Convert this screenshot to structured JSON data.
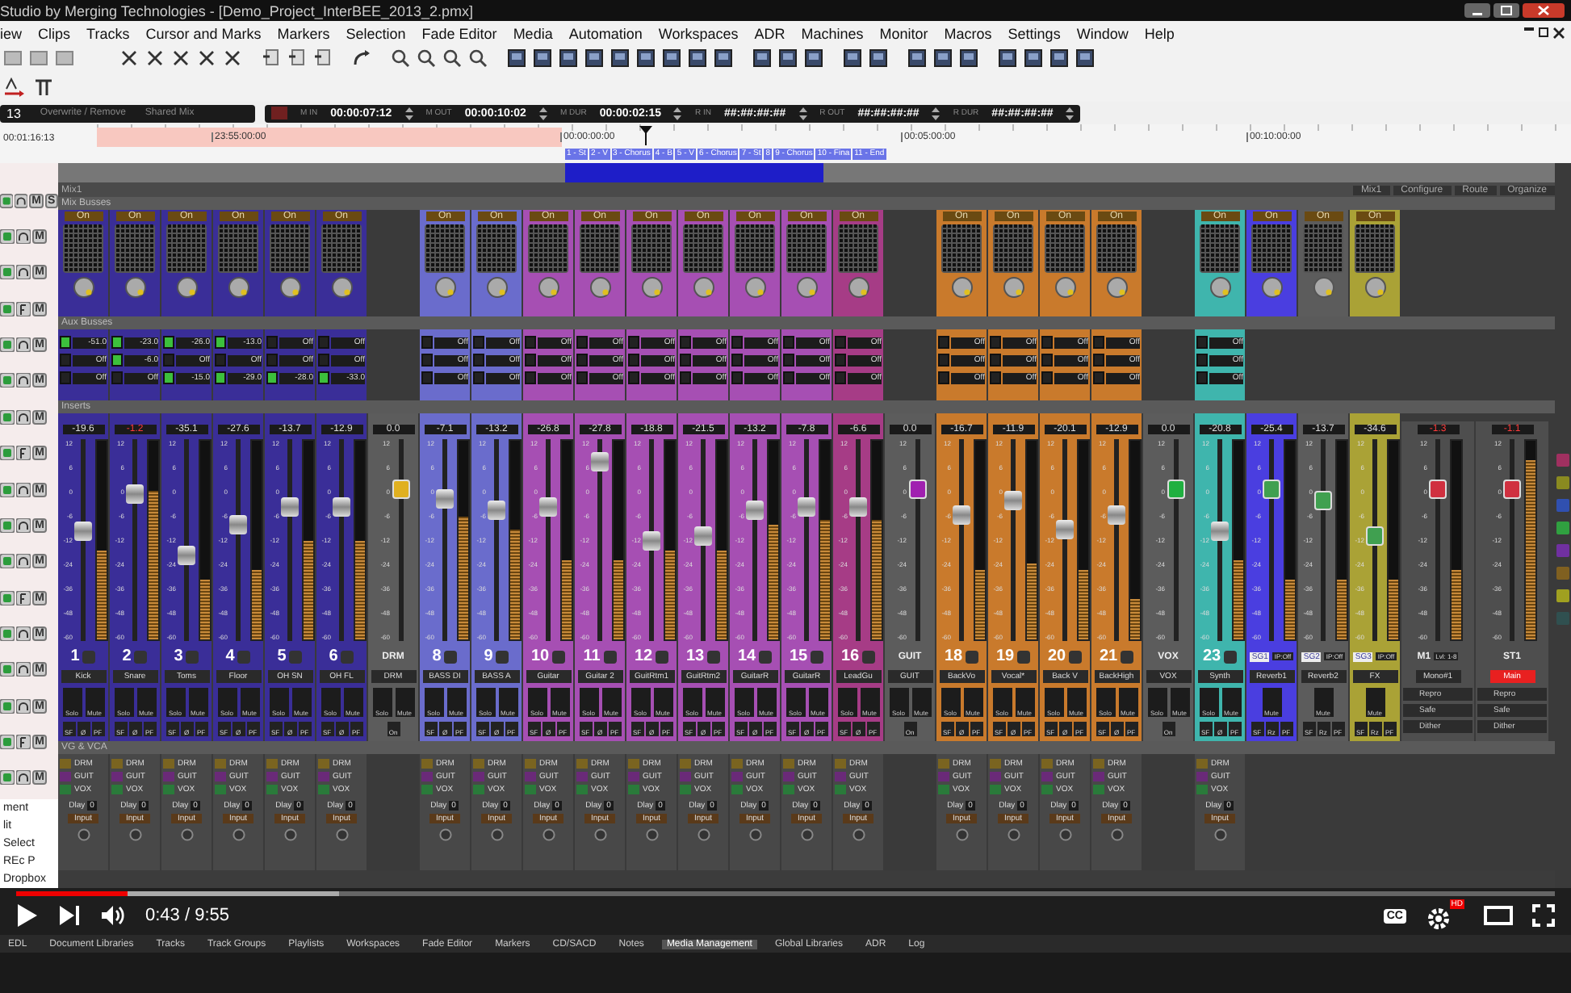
{
  "window": {
    "title": "Studio by Merging Technologies - [Demo_Project_InterBEE_2013_2.pmx]"
  },
  "menu": [
    "iew",
    "Clips",
    "Tracks",
    "Cursor and Marks",
    "Markers",
    "Selection",
    "Fade Editor",
    "Media",
    "Automation",
    "Workspaces",
    "ADR",
    "Machines",
    "Monitor",
    "Macros",
    "Settings",
    "Window",
    "Help"
  ],
  "transport": {
    "track": "13",
    "mode": "Overwrite / Remove",
    "mix": "Shared Mix",
    "fields": [
      {
        "label": "M IN",
        "value": "00:00:07:12"
      },
      {
        "label": "M OUT",
        "value": "00:00:10:02"
      },
      {
        "label": "M DUR",
        "value": "00:00:02:15"
      },
      {
        "label": "R IN",
        "value": "##:##:##:##"
      },
      {
        "label": "R OUT",
        "value": "##:##:##:##"
      },
      {
        "label": "R DUR",
        "value": "##:##:##:##"
      }
    ]
  },
  "ruler": {
    "position": "00:01:16:13",
    "ticks": [
      "23:55:00:00",
      "00:00:00:00",
      "00:05:00:00",
      "00:10:00:00"
    ],
    "markers": [
      "1 - St",
      "2 - V",
      "3 - Chorus",
      "4 - B",
      "5 - V",
      "6 - Chorus",
      "7 - St",
      "8",
      "9 - Chorus",
      "10 - Fina",
      "11 - End"
    ]
  },
  "tracks": [
    {
      "mute": "M",
      "solo": "S"
    },
    {
      "mute": "M"
    },
    {
      "mute": "M"
    },
    {
      "mute": "M"
    },
    {
      "mute": "M"
    },
    {
      "mute": "M"
    },
    {
      "mute": "M"
    },
    {
      "mute": "M"
    },
    {
      "mute": "M"
    },
    {
      "mute": "M"
    },
    {
      "mute": "M"
    },
    {
      "mute": "M"
    },
    {
      "mute": "M"
    },
    {
      "mute": "M"
    },
    {
      "mute": "M"
    },
    {
      "mute": "M"
    },
    {
      "mute": "M"
    }
  ],
  "side_panel": [
    "ment",
    "lit",
    "Select",
    "REc P",
    "Dropbox"
  ],
  "mixer": {
    "title": "Mix1",
    "buttons": [
      "Mix1",
      "Configure",
      "Route",
      "Organize"
    ],
    "sections": [
      "Mix Busses",
      "Aux Busses",
      "Inserts",
      "VG & VCA"
    ],
    "strips": [
      {
        "kind": "channel",
        "number": "1",
        "name": "Kick",
        "gain": "-19.6",
        "peak_warning": false,
        "name_highlighted": false,
        "color": "#3a2e98",
        "scale": [
          "12",
          "6",
          "0",
          "-6",
          "-12",
          "-24",
          "-36",
          "-48",
          "-60"
        ],
        "fader": {
          "level": 0.55
        },
        "meter": {
          "level": 0.45
        },
        "mix_bus": {
          "button": "On"
        },
        "aux": [
          {
            "value": "-51.0",
            "on": true
          },
          {
            "value": "Off",
            "on": false
          },
          {
            "value": "Off",
            "on": false
          }
        ],
        "solo": "Solo",
        "mute": "Mute",
        "flags": [
          "SF",
          "Ø",
          "PF"
        ],
        "vca": {
          "groups": [
            {
              "label": "DRM",
              "color": "#7a6420"
            },
            {
              "label": "GUIT",
              "color": "#6a2a78"
            },
            {
              "label": "VOX",
              "color": "#2a7a3a"
            }
          ],
          "delay_label": "Dlay",
          "delay": "0",
          "input": "Input"
        }
      },
      {
        "kind": "channel",
        "number": "2",
        "name": "Snare",
        "gain": "-1.2",
        "peak_warning": true,
        "name_highlighted": false,
        "color": "#3a2e98",
        "scale": [
          "12",
          "6",
          "0",
          "-6",
          "-12",
          "-24",
          "-36",
          "-48",
          "-60"
        ],
        "fader": {
          "level": 0.75
        },
        "meter": {
          "level": 0.75
        },
        "mix_bus": {
          "button": "On"
        },
        "aux": [
          {
            "value": "-23.0",
            "on": true
          },
          {
            "value": "-6.0",
            "on": true
          },
          {
            "value": "Off",
            "on": false
          }
        ],
        "solo": "Solo",
        "mute": "Mute",
        "flags": [
          "SF",
          "Ø",
          "PF"
        ],
        "vca": {
          "groups": [
            {
              "label": "DRM",
              "color": "#7a6420"
            },
            {
              "label": "GUIT",
              "color": "#6a2a78"
            },
            {
              "label": "VOX",
              "color": "#2a7a3a"
            }
          ],
          "delay_label": "Dlay",
          "delay": "0",
          "input": "Input"
        }
      },
      {
        "kind": "channel",
        "number": "3",
        "name": "Toms",
        "gain": "-35.1",
        "peak_warning": false,
        "name_highlighted": false,
        "color": "#3a2e98",
        "scale": [
          "12",
          "6",
          "0",
          "-6",
          "-12",
          "-24",
          "-36",
          "-48",
          "-60"
        ],
        "fader": {
          "level": 0.42
        },
        "meter": {
          "level": 0.3
        },
        "mix_bus": {
          "button": "On"
        },
        "aux": [
          {
            "value": "-26.0",
            "on": true
          },
          {
            "value": "Off",
            "on": false
          },
          {
            "value": "-15.0",
            "on": true
          }
        ],
        "solo": "Solo",
        "mute": "Mute",
        "flags": [
          "SF",
          "Ø",
          "PF"
        ],
        "vca": {
          "groups": [
            {
              "label": "DRM",
              "color": "#7a6420"
            },
            {
              "label": "GUIT",
              "color": "#6a2a78"
            },
            {
              "label": "VOX",
              "color": "#2a7a3a"
            }
          ],
          "delay_label": "Dlay",
          "delay": "0",
          "input": "Input"
        }
      },
      {
        "kind": "channel",
        "number": "4",
        "name": "Floor",
        "gain": "-27.6",
        "peak_warning": false,
        "name_highlighted": false,
        "color": "#3a2e98",
        "scale": [
          "12",
          "6",
          "0",
          "-6",
          "-12",
          "-24",
          "-36",
          "-48",
          "-60"
        ],
        "fader": {
          "level": 0.58
        },
        "meter": {
          "level": 0.35
        },
        "mix_bus": {
          "button": "On"
        },
        "aux": [
          {
            "value": "-13.0",
            "on": true
          },
          {
            "value": "Off",
            "on": false
          },
          {
            "value": "-29.0",
            "on": true
          }
        ],
        "solo": "Solo",
        "mute": "Mute",
        "flags": [
          "SF",
          "Ø",
          "PF"
        ],
        "vca": {
          "groups": [
            {
              "label": "DRM",
              "color": "#7a6420"
            },
            {
              "label": "GUIT",
              "color": "#6a2a78"
            },
            {
              "label": "VOX",
              "color": "#2a7a3a"
            }
          ],
          "delay_label": "Dlay",
          "delay": "0",
          "input": "Input"
        }
      },
      {
        "kind": "channel",
        "number": "5",
        "name": "OH SN",
        "gain": "-13.7",
        "peak_warning": false,
        "name_highlighted": false,
        "color": "#3a2e98",
        "scale": [
          "12",
          "6",
          "0",
          "-6",
          "-12",
          "-24",
          "-36",
          "-48",
          "-60"
        ],
        "fader": {
          "level": 0.68
        },
        "meter": {
          "level": 0.5
        },
        "mix_bus": {
          "button": "On"
        },
        "aux": [
          {
            "value": "Off",
            "on": false
          },
          {
            "value": "Off",
            "on": false
          },
          {
            "value": "-28.0",
            "on": true
          }
        ],
        "solo": "Solo",
        "mute": "Mute",
        "flags": [
          "SF",
          "Ø",
          "PF"
        ],
        "vca": {
          "groups": [
            {
              "label": "DRM",
              "color": "#7a6420"
            },
            {
              "label": "GUIT",
              "color": "#6a2a78"
            },
            {
              "label": "VOX",
              "color": "#2a7a3a"
            }
          ],
          "delay_label": "Dlay",
          "delay": "0",
          "input": "Input"
        }
      },
      {
        "kind": "channel",
        "number": "6",
        "name": "OH FL",
        "gain": "-12.9",
        "peak_warning": false,
        "name_highlighted": false,
        "color": "#3a2e98",
        "scale": [
          "12",
          "6",
          "0",
          "-6",
          "-12",
          "-24",
          "-36",
          "-48",
          "-60"
        ],
        "fader": {
          "level": 0.68
        },
        "meter": {
          "level": 0.5
        },
        "mix_bus": {
          "button": "On"
        },
        "aux": [
          {
            "value": "Off",
            "on": false
          },
          {
            "value": "Off",
            "on": false
          },
          {
            "value": "-33.0",
            "on": true
          }
        ],
        "solo": "Solo",
        "mute": "Mute",
        "flags": [
          "SF",
          "Ø",
          "PF"
        ],
        "vca": {
          "groups": [
            {
              "label": "DRM",
              "color": "#7a6420"
            },
            {
              "label": "GUIT",
              "color": "#6a2a78"
            },
            {
              "label": "VOX",
              "color": "#2a7a3a"
            }
          ],
          "delay_label": "Dlay",
          "delay": "0",
          "input": "Input"
        }
      },
      {
        "kind": "group",
        "tag": "DRM",
        "name": "DRM",
        "gain": "0.0",
        "peak_warning": false,
        "name_highlighted": false,
        "color": "#5c5c5c",
        "scale": [
          "12",
          "6",
          "0",
          "-6",
          "-12",
          "-24",
          "-36",
          "-48",
          "-60"
        ],
        "fader": {
          "level": 0.78,
          "color": "#e0b020"
        },
        "solo": "Solo",
        "mute": "Mute",
        "flags": [
          "On"
        ]
      },
      {
        "kind": "channel",
        "number": "8",
        "name": "BASS DI",
        "gain": "-7.1",
        "peak_warning": false,
        "name_highlighted": false,
        "color": "#6a6ccc",
        "scale": [
          "12",
          "6",
          "0",
          "-6",
          "-12",
          "-24",
          "-36",
          "-48",
          "-60"
        ],
        "fader": {
          "level": 0.73
        },
        "meter": {
          "level": 0.62
        },
        "mix_bus": {
          "button": "On"
        },
        "aux": [
          {
            "value": "Off",
            "on": false
          },
          {
            "value": "Off",
            "on": false
          },
          {
            "value": "Off",
            "on": false
          }
        ],
        "solo": "Solo",
        "mute": "Mute",
        "flags": [
          "SF",
          "Ø",
          "PF"
        ],
        "vca": {
          "groups": [
            {
              "label": "DRM",
              "color": "#7a6420"
            },
            {
              "label": "GUIT",
              "color": "#6a2a78"
            },
            {
              "label": "VOX",
              "color": "#2a7a3a"
            }
          ],
          "delay_label": "Dlay",
          "delay": "0",
          "input": "Input"
        }
      },
      {
        "kind": "channel",
        "number": "9",
        "name": "BASS A",
        "gain": "-13.2",
        "peak_warning": false,
        "name_highlighted": false,
        "color": "#6a6ccc",
        "scale": [
          "12",
          "6",
          "0",
          "-6",
          "-12",
          "-24",
          "-36",
          "-48",
          "-60"
        ],
        "fader": {
          "level": 0.66
        },
        "meter": {
          "level": 0.55
        },
        "mix_bus": {
          "button": "On"
        },
        "aux": [
          {
            "value": "Off",
            "on": false
          },
          {
            "value": "Off",
            "on": false
          },
          {
            "value": "Off",
            "on": false
          }
        ],
        "solo": "Solo",
        "mute": "Mute",
        "flags": [
          "SF",
          "Ø",
          "PF"
        ],
        "vca": {
          "groups": [
            {
              "label": "DRM",
              "color": "#7a6420"
            },
            {
              "label": "GUIT",
              "color": "#6a2a78"
            },
            {
              "label": "VOX",
              "color": "#2a7a3a"
            }
          ],
          "delay_label": "Dlay",
          "delay": "0",
          "input": "Input"
        }
      },
      {
        "kind": "channel",
        "number": "10",
        "name": "Guitar",
        "gain": "-26.8",
        "peak_warning": false,
        "name_highlighted": false,
        "color": "#a64fb3",
        "scale": [
          "12",
          "6",
          "0",
          "-6",
          "-12",
          "-24",
          "-36",
          "-48",
          "-60"
        ],
        "fader": {
          "level": 0.68
        },
        "meter": {
          "level": 0.4
        },
        "mix_bus": {
          "button": "On"
        },
        "aux": [
          {
            "value": "Off",
            "on": false
          },
          {
            "value": "Off",
            "on": false
          },
          {
            "value": "Off",
            "on": false
          }
        ],
        "solo": "Solo",
        "mute": "Mute",
        "flags": [
          "SF",
          "Ø",
          "PF"
        ],
        "vca": {
          "groups": [
            {
              "label": "DRM",
              "color": "#7a6420"
            },
            {
              "label": "GUIT",
              "color": "#6a2a78"
            },
            {
              "label": "VOX",
              "color": "#2a7a3a"
            }
          ],
          "delay_label": "Dlay",
          "delay": "0",
          "input": "Input"
        }
      },
      {
        "kind": "channel",
        "number": "11",
        "name": "Guitar 2",
        "gain": "-27.8",
        "peak_warning": false,
        "name_highlighted": false,
        "color": "#a64fb3",
        "scale": [
          "12",
          "6",
          "0",
          "-6",
          "-12",
          "-24",
          "-36",
          "-48",
          "-60"
        ],
        "fader": {
          "level": 0.93
        },
        "meter": {
          "level": 0.4
        },
        "mix_bus": {
          "button": "On"
        },
        "aux": [
          {
            "value": "Off",
            "on": false
          },
          {
            "value": "Off",
            "on": false
          },
          {
            "value": "Off",
            "on": false
          }
        ],
        "solo": "Solo",
        "mute": "Mute",
        "flags": [
          "SF",
          "Ø",
          "PF"
        ],
        "vca": {
          "groups": [
            {
              "label": "DRM",
              "color": "#7a6420"
            },
            {
              "label": "GUIT",
              "color": "#6a2a78"
            },
            {
              "label": "VOX",
              "color": "#2a7a3a"
            }
          ],
          "delay_label": "Dlay",
          "delay": "0",
          "input": "Input"
        }
      },
      {
        "kind": "channel",
        "number": "12",
        "name": "GuitRtm1",
        "gain": "-18.8",
        "peak_warning": false,
        "name_highlighted": false,
        "color": "#a64fb3",
        "scale": [
          "12",
          "6",
          "0",
          "-6",
          "-12",
          "-24",
          "-36",
          "-48",
          "-60"
        ],
        "fader": {
          "level": 0.5
        },
        "meter": {
          "level": 0.45
        },
        "mix_bus": {
          "button": "On"
        },
        "aux": [
          {
            "value": "Off",
            "on": false
          },
          {
            "value": "Off",
            "on": false
          },
          {
            "value": "Off",
            "on": false
          }
        ],
        "solo": "Solo",
        "mute": "Mute",
        "flags": [
          "SF",
          "Ø",
          "PF"
        ],
        "vca": {
          "groups": [
            {
              "label": "DRM",
              "color": "#7a6420"
            },
            {
              "label": "GUIT",
              "color": "#6a2a78"
            },
            {
              "label": "VOX",
              "color": "#2a7a3a"
            }
          ],
          "delay_label": "Dlay",
          "delay": "0",
          "input": "Input"
        }
      },
      {
        "kind": "channel",
        "number": "13",
        "name": "GuitRtm2",
        "gain": "-21.5",
        "peak_warning": false,
        "name_highlighted": false,
        "color": "#a64fb3",
        "scale": [
          "12",
          "6",
          "0",
          "-6",
          "-12",
          "-24",
          "-36",
          "-48",
          "-60"
        ],
        "fader": {
          "level": 0.52
        },
        "meter": {
          "level": 0.45
        },
        "mix_bus": {
          "button": "On"
        },
        "aux": [
          {
            "value": "Off",
            "on": false
          },
          {
            "value": "Off",
            "on": false
          },
          {
            "value": "Off",
            "on": false
          }
        ],
        "solo": "Solo",
        "mute": "Mute",
        "flags": [
          "SF",
          "Ø",
          "PF"
        ],
        "vca": {
          "groups": [
            {
              "label": "DRM",
              "color": "#7a6420"
            },
            {
              "label": "GUIT",
              "color": "#6a2a78"
            },
            {
              "label": "VOX",
              "color": "#2a7a3a"
            }
          ],
          "delay_label": "Dlay",
          "delay": "0",
          "input": "Input"
        }
      },
      {
        "kind": "channel",
        "number": "14",
        "name": "GuitarR",
        "gain": "-13.2",
        "peak_warning": false,
        "name_highlighted": false,
        "color": "#a64fb3",
        "scale": [
          "12",
          "6",
          "0",
          "-6",
          "-12",
          "-24",
          "-36",
          "-48",
          "-60"
        ],
        "fader": {
          "level": 0.66
        },
        "meter": {
          "level": 0.58
        },
        "mix_bus": {
          "button": "On"
        },
        "aux": [
          {
            "value": "Off",
            "on": false
          },
          {
            "value": "Off",
            "on": false
          },
          {
            "value": "Off",
            "on": false
          }
        ],
        "solo": "Solo",
        "mute": "Mute",
        "flags": [
          "SF",
          "Ø",
          "PF"
        ],
        "vca": {
          "groups": [
            {
              "label": "DRM",
              "color": "#7a6420"
            },
            {
              "label": "GUIT",
              "color": "#6a2a78"
            },
            {
              "label": "VOX",
              "color": "#2a7a3a"
            }
          ],
          "delay_label": "Dlay",
          "delay": "0",
          "input": "Input"
        }
      },
      {
        "kind": "channel",
        "number": "15",
        "name": "GuitarR",
        "gain": "-7.8",
        "peak_warning": false,
        "name_highlighted": false,
        "color": "#a64fb3",
        "scale": [
          "12",
          "6",
          "0",
          "-6",
          "-12",
          "-24",
          "-36",
          "-48",
          "-60"
        ],
        "fader": {
          "level": 0.68
        },
        "meter": {
          "level": 0.6
        },
        "mix_bus": {
          "button": "On"
        },
        "aux": [
          {
            "value": "Off",
            "on": false
          },
          {
            "value": "Off",
            "on": false
          },
          {
            "value": "Off",
            "on": false
          }
        ],
        "solo": "Solo",
        "mute": "Mute",
        "flags": [
          "SF",
          "Ø",
          "PF"
        ],
        "vca": {
          "groups": [
            {
              "label": "DRM",
              "color": "#7a6420"
            },
            {
              "label": "GUIT",
              "color": "#6a2a78"
            },
            {
              "label": "VOX",
              "color": "#2a7a3a"
            }
          ],
          "delay_label": "Dlay",
          "delay": "0",
          "input": "Input"
        }
      },
      {
        "kind": "channel",
        "number": "16",
        "name": "LeadGu",
        "gain": "-6.6",
        "peak_warning": false,
        "name_highlighted": false,
        "color": "#a63c86",
        "scale": [
          "12",
          "6",
          "0",
          "-6",
          "-12",
          "-24",
          "-36",
          "-48",
          "-60"
        ],
        "fader": {
          "level": 0.68
        },
        "meter": {
          "level": 0.6
        },
        "mix_bus": {
          "button": "On"
        },
        "aux": [
          {
            "value": "Off",
            "on": false
          },
          {
            "value": "Off",
            "on": false
          },
          {
            "value": "Off",
            "on": false
          }
        ],
        "solo": "Solo",
        "mute": "Mute",
        "flags": [
          "SF",
          "Ø",
          "PF"
        ],
        "vca": {
          "groups": [
            {
              "label": "DRM",
              "color": "#7a6420"
            },
            {
              "label": "GUIT",
              "color": "#6a2a78"
            },
            {
              "label": "VOX",
              "color": "#2a7a3a"
            }
          ],
          "delay_label": "Dlay",
          "delay": "0",
          "input": "Input"
        }
      },
      {
        "kind": "group",
        "tag": "GUIT",
        "name": "GUIT",
        "gain": "0.0",
        "peak_warning": false,
        "name_highlighted": false,
        "color": "#5c5c5c",
        "scale": [
          "12",
          "6",
          "0",
          "-6",
          "-12",
          "-24",
          "-36",
          "-48",
          "-60"
        ],
        "fader": {
          "level": 0.78,
          "color": "#a020b0"
        },
        "solo": "Solo",
        "mute": "Mute",
        "flags": [
          "On"
        ]
      },
      {
        "kind": "channel",
        "number": "18",
        "name": "BackVo",
        "gain": "-16.7",
        "peak_warning": false,
        "name_highlighted": false,
        "color": "#c97a2c",
        "scale": [
          "12",
          "6",
          "0",
          "-6",
          "-12",
          "-24",
          "-36",
          "-48",
          "-60"
        ],
        "fader": {
          "level": 0.64
        },
        "meter": {
          "level": 0.35
        },
        "mix_bus": {
          "button": "On"
        },
        "aux": [
          {
            "value": "Off",
            "on": false
          },
          {
            "value": "Off",
            "on": false
          },
          {
            "value": "Off",
            "on": false
          }
        ],
        "solo": "Solo",
        "mute": "Mute",
        "flags": [
          "SF",
          "Ø",
          "PF"
        ],
        "vca": {
          "groups": [
            {
              "label": "DRM",
              "color": "#7a6420"
            },
            {
              "label": "GUIT",
              "color": "#6a2a78"
            },
            {
              "label": "VOX",
              "color": "#2a7a3a"
            }
          ],
          "delay_label": "Dlay",
          "delay": "0",
          "input": "Input"
        }
      },
      {
        "kind": "channel",
        "number": "19",
        "name": "Vocal*",
        "gain": "-11.9",
        "peak_warning": false,
        "name_highlighted": false,
        "color": "#c97a2c",
        "scale": [
          "12",
          "6",
          "0",
          "-6",
          "-12",
          "-24",
          "-36",
          "-48",
          "-60"
        ],
        "fader": {
          "level": 0.72
        },
        "meter": {
          "level": 0.38
        },
        "mix_bus": {
          "button": "On"
        },
        "aux": [
          {
            "value": "Off",
            "on": false
          },
          {
            "value": "Off",
            "on": false
          },
          {
            "value": "Off",
            "on": false
          }
        ],
        "solo": "Solo",
        "mute": "Mute",
        "flags": [
          "SF",
          "Ø",
          "PF"
        ],
        "vca": {
          "groups": [
            {
              "label": "DRM",
              "color": "#7a6420"
            },
            {
              "label": "GUIT",
              "color": "#6a2a78"
            },
            {
              "label": "VOX",
              "color": "#2a7a3a"
            }
          ],
          "delay_label": "Dlay",
          "delay": "0",
          "input": "Input"
        }
      },
      {
        "kind": "channel",
        "number": "20",
        "name": "Back V",
        "gain": "-20.1",
        "peak_warning": false,
        "name_highlighted": false,
        "color": "#c97a2c",
        "scale": [
          "12",
          "6",
          "0",
          "-6",
          "-12",
          "-24",
          "-36",
          "-48",
          "-60"
        ],
        "fader": {
          "level": 0.56
        },
        "meter": {
          "level": 0.35
        },
        "mix_bus": {
          "button": "On"
        },
        "aux": [
          {
            "value": "Off",
            "on": false
          },
          {
            "value": "Off",
            "on": false
          },
          {
            "value": "Off",
            "on": false
          }
        ],
        "solo": "Solo",
        "mute": "Mute",
        "flags": [
          "SF",
          "Ø",
          "PF"
        ],
        "vca": {
          "groups": [
            {
              "label": "DRM",
              "color": "#7a6420"
            },
            {
              "label": "GUIT",
              "color": "#6a2a78"
            },
            {
              "label": "VOX",
              "color": "#2a7a3a"
            }
          ],
          "delay_label": "Dlay",
          "delay": "0",
          "input": "Input"
        }
      },
      {
        "kind": "channel",
        "number": "21",
        "name": "BackHigh",
        "gain": "-12.9",
        "peak_warning": false,
        "name_highlighted": false,
        "color": "#c97a2c",
        "scale": [
          "12",
          "6",
          "0",
          "-6",
          "-12",
          "-24",
          "-36",
          "-48",
          "-60"
        ],
        "fader": {
          "level": 0.64
        },
        "meter": {
          "level": 0.2
        },
        "mix_bus": {
          "button": "On"
        },
        "aux": [
          {
            "value": "Off",
            "on": false
          },
          {
            "value": "Off",
            "on": false
          },
          {
            "value": "Off",
            "on": false
          }
        ],
        "solo": "Solo",
        "mute": "Mute",
        "flags": [
          "SF",
          "Ø",
          "PF"
        ],
        "vca": {
          "groups": [
            {
              "label": "DRM",
              "color": "#7a6420"
            },
            {
              "label": "GUIT",
              "color": "#6a2a78"
            },
            {
              "label": "VOX",
              "color": "#2a7a3a"
            }
          ],
          "delay_label": "Dlay",
          "delay": "0",
          "input": "Input"
        }
      },
      {
        "kind": "group",
        "tag": "VOX",
        "name": "VOX",
        "gain": "0.0",
        "peak_warning": false,
        "name_highlighted": false,
        "color": "#5c5c5c",
        "scale": [
          "12",
          "6",
          "0",
          "-6",
          "-12",
          "-24",
          "-36",
          "-48",
          "-60"
        ],
        "fader": {
          "level": 0.78,
          "color": "#20b040"
        },
        "solo": "Solo",
        "mute": "Mute",
        "flags": [
          "On"
        ]
      },
      {
        "kind": "channel",
        "number": "23",
        "name": "Synth",
        "gain": "-20.8",
        "peak_warning": false,
        "name_highlighted": false,
        "color": "#3fb5ad",
        "scale": [
          "12",
          "6",
          "0",
          "-6",
          "-12",
          "-24",
          "-36",
          "-48",
          "-60"
        ],
        "fader": {
          "level": 0.55
        },
        "meter": {
          "level": 0.4
        },
        "mix_bus": {
          "button": "On"
        },
        "aux": [
          {
            "value": "Off",
            "on": false
          },
          {
            "value": "Off",
            "on": false
          },
          {
            "value": "Off",
            "on": false
          }
        ],
        "solo": "Solo",
        "mute": "Mute",
        "flags": [
          "SF",
          "Ø",
          "PF"
        ],
        "vca": {
          "groups": [
            {
              "label": "DRM",
              "color": "#7a6420"
            },
            {
              "label": "GUIT",
              "color": "#6a2a78"
            },
            {
              "label": "VOX",
              "color": "#2a7a3a"
            }
          ],
          "delay_label": "Dlay",
          "delay": "0",
          "input": "Input"
        }
      },
      {
        "kind": "bus",
        "tag": "SG1",
        "tag_value": "IP:Off",
        "name": "Reverb1",
        "gain": "-25.4",
        "peak_warning": false,
        "name_highlighted": false,
        "color": "#4a3ee0",
        "scale": [
          "12",
          "6",
          "0",
          "-6",
          "-12",
          "-24",
          "-36",
          "-48",
          "-60"
        ],
        "fader": {
          "level": 0.78,
          "color": "#40a050"
        },
        "meter": {
          "level": 0.3
        },
        "mix_bus": {
          "button": "On"
        },
        "mute": "Mute",
        "flags": [
          "SF",
          "Rz",
          "PF"
        ]
      },
      {
        "kind": "bus",
        "tag": "SG2",
        "tag_value": "IP:Off",
        "name": "Reverb2",
        "gain": "-13.7",
        "peak_warning": false,
        "name_highlighted": false,
        "color": "#5c5c5c",
        "scale": [
          "12",
          "6",
          "0",
          "-6",
          "-12",
          "-24",
          "-36",
          "-48",
          "-60"
        ],
        "fader": {
          "level": 0.72,
          "color": "#40a050"
        },
        "meter": {
          "level": 0.3
        },
        "mix_bus": {
          "button": "On"
        },
        "mute": "Mute",
        "flags": [
          "SF",
          "Rz",
          "PF"
        ]
      },
      {
        "kind": "bus",
        "tag": "SG3",
        "tag_value": "IP:Off",
        "name": "FX",
        "gain": "-34.6",
        "peak_warning": false,
        "name_highlighted": false,
        "color": "#aaa236",
        "scale": [
          "12",
          "6",
          "0",
          "-6",
          "-12",
          "-24",
          "-36",
          "-48",
          "-60"
        ],
        "fader": {
          "level": 0.52,
          "color": "#40a050"
        },
        "meter": {
          "level": 0.3
        },
        "mix_bus": {
          "button": "On"
        },
        "mute": "Mute",
        "flags": [
          "SF",
          "Rz",
          "PF"
        ]
      },
      {
        "kind": "master",
        "tag": "M1",
        "tag_value": "Lvl: 1-8",
        "name": "Mono#1",
        "gain": "-1.3",
        "peak_warning": true,
        "name_highlighted": false,
        "color": "#4e4e4e",
        "scale": [
          "12",
          "6",
          "0",
          "-6",
          "-12",
          "-24",
          "-36",
          "-48",
          "-60"
        ],
        "fader": {
          "level": 0.78,
          "color": "#d03040"
        },
        "meter": {
          "level": 0.35
        },
        "options": [
          "Repro",
          "Safe",
          "Dither"
        ]
      },
      {
        "kind": "master",
        "tag": "ST1",
        "name": "Main",
        "gain": "-1.1",
        "peak_warning": true,
        "name_highlighted": true,
        "color": "#4e4e4e",
        "scale": [
          "12",
          "6",
          "0",
          "-6",
          "-12",
          "-24",
          "-36",
          "-48",
          "-60"
        ],
        "fader": {
          "level": 0.78,
          "color": "#d03040"
        },
        "meter": {
          "level": 0.9
        },
        "options": [
          "Repro",
          "Safe",
          "Dither"
        ]
      }
    ]
  },
  "player": {
    "time": "0:43 / 9:55",
    "progress": {
      "level": 0.072
    },
    "buffer": {
      "level": 0.21
    },
    "captions": "CC",
    "quality": "HD"
  },
  "tabs": [
    {
      "label": "EDL",
      "selected": false
    },
    {
      "label": "Document Libraries",
      "selected": false
    },
    {
      "label": "Tracks",
      "selected": false
    },
    {
      "label": "Track Groups",
      "selected": false
    },
    {
      "label": "Playlists",
      "selected": false
    },
    {
      "label": "Workspaces",
      "selected": false
    },
    {
      "label": "Fade Editor",
      "selected": false
    },
    {
      "label": "Markers",
      "selected": false
    },
    {
      "label": "CD/SACD",
      "selected": false
    },
    {
      "label": "Notes",
      "selected": false
    },
    {
      "label": "Media Management",
      "selected": true
    },
    {
      "label": "Global Libraries",
      "selected": false
    },
    {
      "label": "ADR",
      "selected": false
    },
    {
      "label": "Log",
      "selected": false
    }
  ]
}
